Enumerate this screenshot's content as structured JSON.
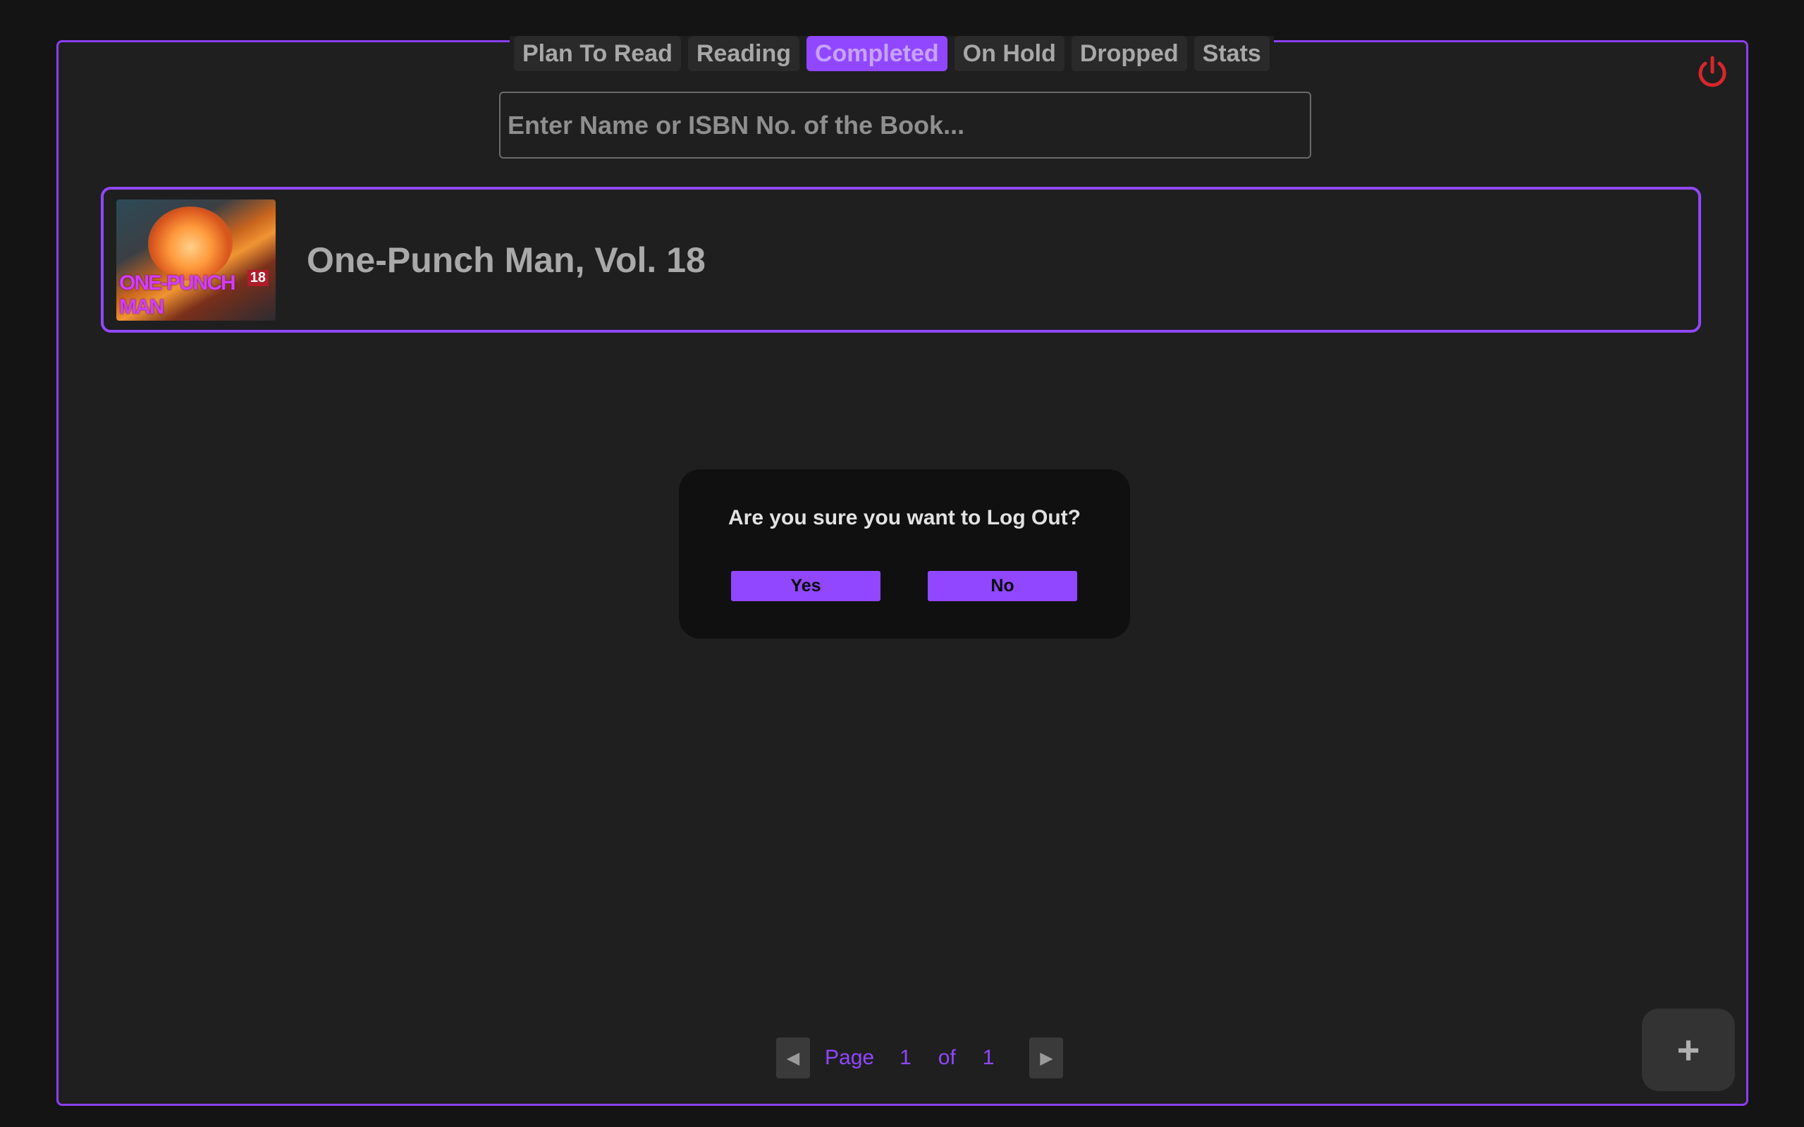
{
  "tabs": [
    {
      "label": "Plan To Read",
      "active": false
    },
    {
      "label": "Reading",
      "active": false
    },
    {
      "label": "Completed",
      "active": true
    },
    {
      "label": "On Hold",
      "active": false
    },
    {
      "label": "Dropped",
      "active": false
    },
    {
      "label": "Stats",
      "active": false
    }
  ],
  "search": {
    "placeholder": "Enter Name or ISBN No. of the Book...",
    "value": ""
  },
  "books": [
    {
      "title": "One-Punch Man, Vol. 18",
      "cover_volume": "18",
      "cover_logo": "ONE-PUNCH MAN"
    }
  ],
  "dialog": {
    "message": "Are you sure you want to Log Out?",
    "yes_label": "Yes",
    "no_label": "No"
  },
  "pagination": {
    "page_label": "Page",
    "current": "1",
    "of_label": "of",
    "total": "1",
    "prev_icon": "◀",
    "next_icon": "▶"
  },
  "fab": {
    "label": "+"
  },
  "icons": {
    "logout": "power-icon",
    "add": "plus-icon"
  },
  "colors": {
    "accent": "#9147ff",
    "logout": "#d8262c",
    "background": "#1f1f1f"
  }
}
